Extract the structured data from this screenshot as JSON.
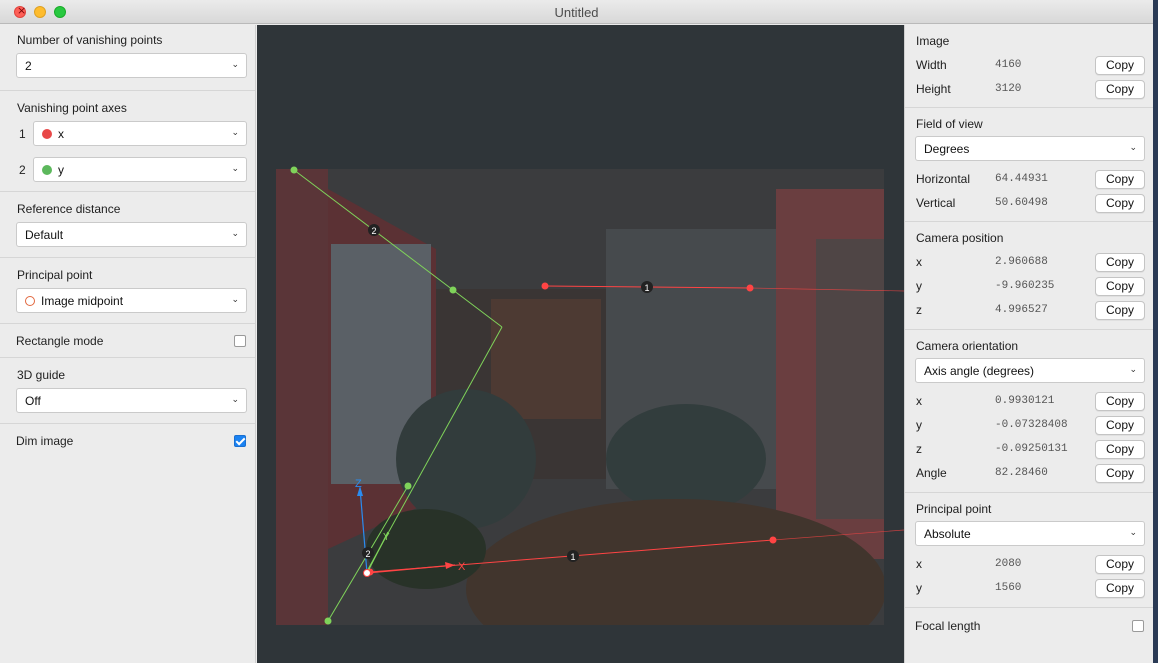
{
  "window": {
    "title": "Untitled"
  },
  "left": {
    "num_vp_label": "Number of vanishing points",
    "num_vp_value": "2",
    "vp_axes_label": "Vanishing point axes",
    "axes": [
      {
        "num": "1",
        "value": "x",
        "color": "#e84848"
      },
      {
        "num": "2",
        "value": "y",
        "color": "#5cb85c"
      }
    ],
    "ref_dist_label": "Reference distance",
    "ref_dist_value": "Default",
    "pp_label": "Principal point",
    "pp_value": "Image midpoint",
    "rect_mode_label": "Rectangle mode",
    "rect_mode_checked": false,
    "guide_label": "3D guide",
    "guide_value": "Off",
    "dim_label": "Dim image",
    "dim_checked": true
  },
  "canvas": {
    "vp1_badge": "1",
    "vp2_badge": "2",
    "axis_z": "Z",
    "axis_y": "Y",
    "axis_x": "X",
    "colors": {
      "vp1": "#ff4444",
      "vp2": "#7fd35a",
      "z": "#2a8cf0"
    }
  },
  "right": {
    "copy_label": "Copy",
    "image": {
      "label": "Image",
      "rows": [
        {
          "key": "Width",
          "value": "4160"
        },
        {
          "key": "Height",
          "value": "3120"
        }
      ]
    },
    "fov": {
      "label": "Field of view",
      "select": "Degrees",
      "rows": [
        {
          "key": "Horizontal",
          "value": "64.44931"
        },
        {
          "key": "Vertical",
          "value": "50.60498"
        }
      ]
    },
    "cam_pos": {
      "label": "Camera position",
      "rows": [
        {
          "key": "x",
          "value": "2.960688"
        },
        {
          "key": "y",
          "value": "-9.960235"
        },
        {
          "key": "z",
          "value": "4.996527"
        }
      ]
    },
    "cam_orient": {
      "label": "Camera orientation",
      "select": "Axis angle (degrees)",
      "rows": [
        {
          "key": "x",
          "value": "0.9930121"
        },
        {
          "key": "y",
          "value": "-0.07328408"
        },
        {
          "key": "z",
          "value": "-0.09250131"
        },
        {
          "key": "Angle",
          "value": "82.28460"
        }
      ]
    },
    "pp": {
      "label": "Principal point",
      "select": "Absolute",
      "rows": [
        {
          "key": "x",
          "value": "2080"
        },
        {
          "key": "y",
          "value": "1560"
        }
      ]
    },
    "focal_label": "Focal length",
    "focal_checked": false
  }
}
